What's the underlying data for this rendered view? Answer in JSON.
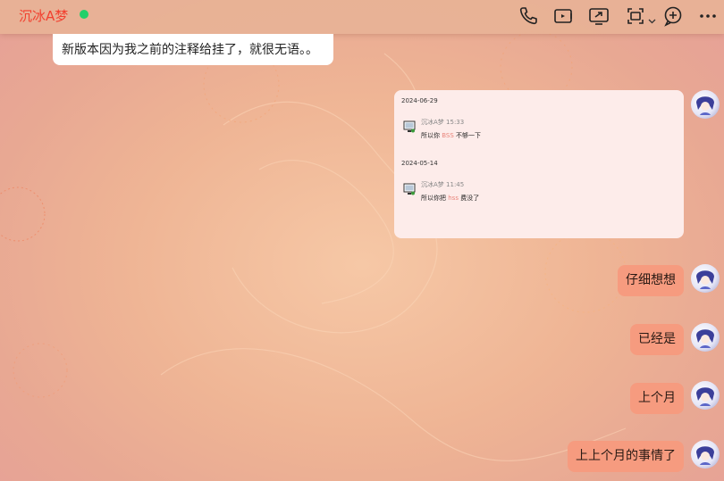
{
  "header": {
    "contact_name": "沉冰A梦",
    "online_color": "#22d06a",
    "icons": [
      "phone-icon",
      "video-icon",
      "screen-share-icon",
      "remote-assist-icon",
      "add-member-icon",
      "more-icon"
    ]
  },
  "messages": [
    {
      "side": "left",
      "text": "新版本因为我之前的注释给挂了，就很无语。。"
    },
    {
      "side": "right",
      "type": "forwarded",
      "entries": [
        {
          "date": "2024-06-29",
          "sender": "沉冰A梦",
          "time": "15:33",
          "prefix": "所以你",
          "highlight": "BSS",
          "suffix": "不够一下"
        },
        {
          "date": "2024-05-14",
          "sender": "沉冰A梦",
          "time": "11:45",
          "prefix": "所以你把",
          "highlight": "hss",
          "suffix": "费没了"
        }
      ]
    },
    {
      "side": "right",
      "text": "仔细想想"
    },
    {
      "side": "right",
      "text": "已经是"
    },
    {
      "side": "right",
      "text": "上个月"
    },
    {
      "side": "right",
      "text": "上上个月的事情了"
    }
  ],
  "colors": {
    "accent": "#f2402f",
    "bubble_self": "#f69b7f",
    "forward_card": "#fdecea"
  }
}
